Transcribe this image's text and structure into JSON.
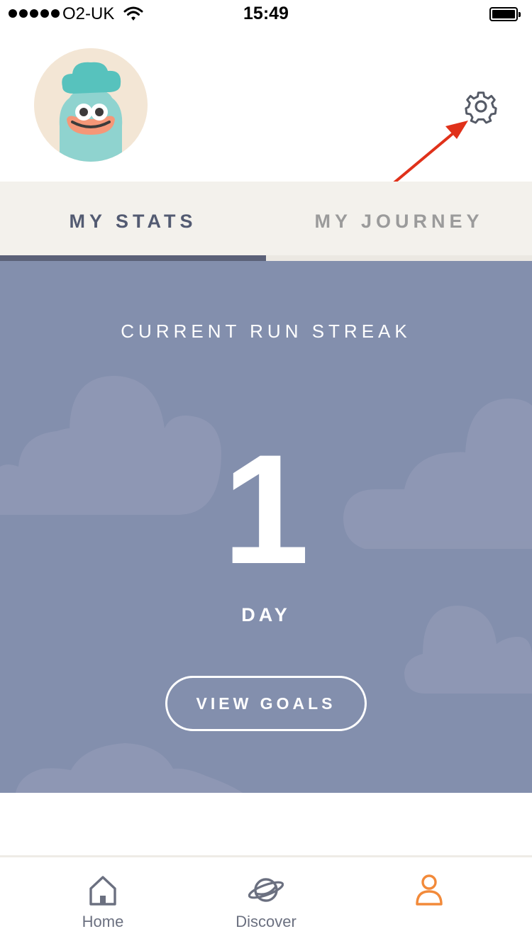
{
  "status_bar": {
    "carrier": "O2-UK",
    "time": "15:49",
    "icons": [
      "signal-dots-icon",
      "wifi-icon",
      "battery-icon"
    ]
  },
  "header": {
    "avatar_icon": "monster-avatar-icon",
    "settings_icon": "gear-icon",
    "annotation_icon": "red-arrow-icon"
  },
  "tabs": {
    "items": [
      {
        "label": "MY STATS",
        "active": true
      },
      {
        "label": "MY JOURNEY",
        "active": false
      }
    ]
  },
  "stats": {
    "streak_label": "CURRENT RUN STREAK",
    "streak_value": "1",
    "streak_unit": "DAY",
    "view_goals_label": "VIEW GOALS"
  },
  "bottom_nav": {
    "items": [
      {
        "label": "Home",
        "icon": "home-icon",
        "active": false
      },
      {
        "label": "Discover",
        "icon": "planet-icon",
        "active": false
      },
      {
        "label": "",
        "icon": "profile-icon",
        "active": true
      }
    ]
  },
  "colors": {
    "panel_bg": "#838fad",
    "cloud": "#9099b5",
    "tab_bar_bg": "#f3f1ec",
    "tab_active_text": "#535b72",
    "tab_inactive_text": "#9b9b9b",
    "accent_orange": "#f28a3a",
    "annotation_red": "#e0311a"
  }
}
